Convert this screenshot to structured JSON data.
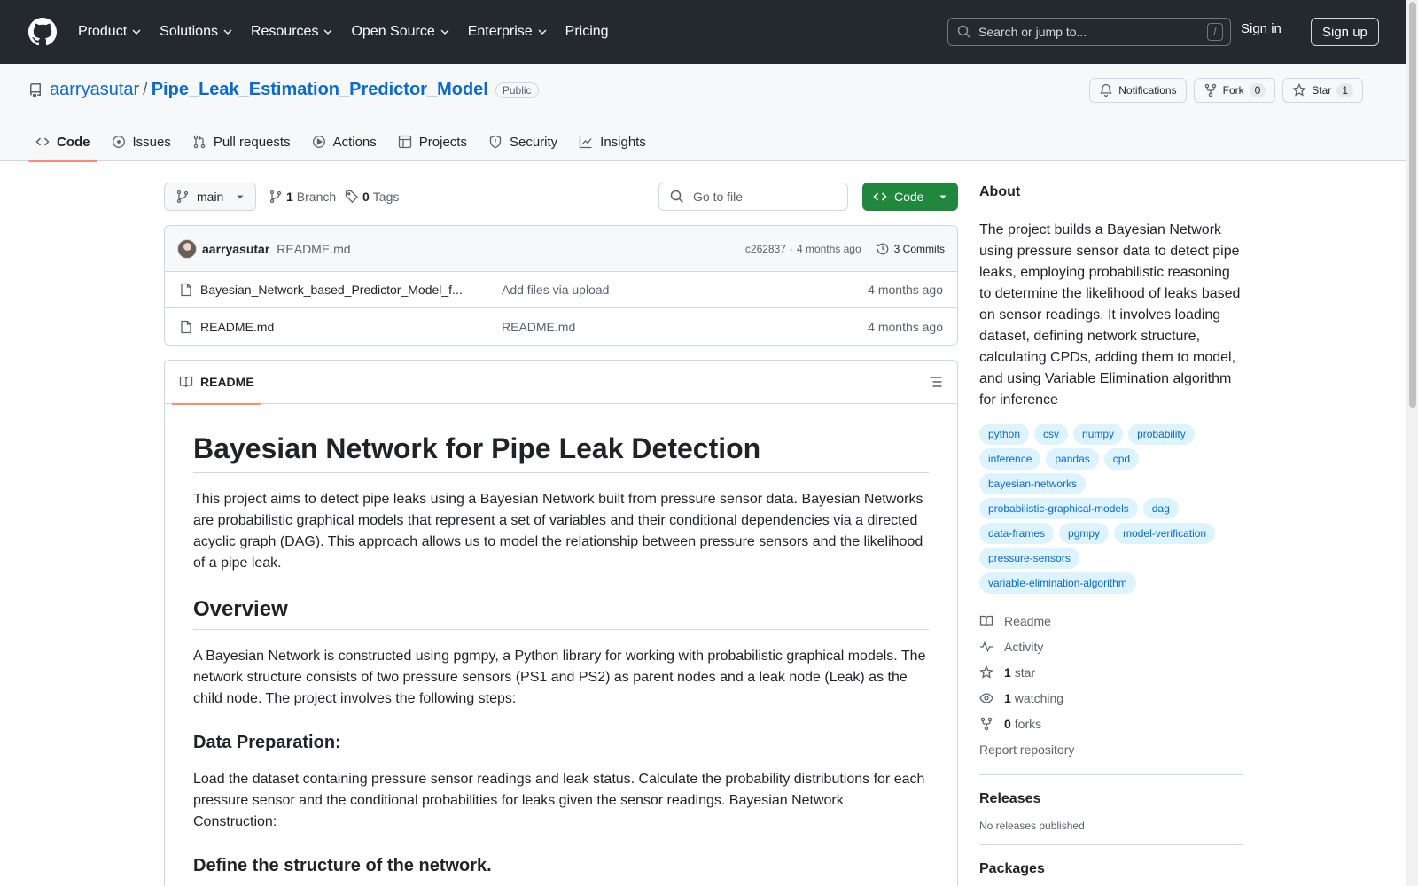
{
  "header": {
    "nav": [
      {
        "label": "Product",
        "dropdown": true
      },
      {
        "label": "Solutions",
        "dropdown": true
      },
      {
        "label": "Resources",
        "dropdown": true
      },
      {
        "label": "Open Source",
        "dropdown": true
      },
      {
        "label": "Enterprise",
        "dropdown": true
      },
      {
        "label": "Pricing",
        "dropdown": false
      }
    ],
    "search_placeholder": "Search or jump to...",
    "search_shortcut": "/",
    "sign_in": "Sign in",
    "sign_up": "Sign up"
  },
  "repo": {
    "owner": "aarryasutar",
    "separator": "/",
    "name": "Pipe_Leak_Estimation_Predictor_Model",
    "visibility": "Public",
    "notifications_label": "Notifications",
    "fork_label": "Fork",
    "fork_count": "0",
    "star_label": "Star",
    "star_count": "1",
    "tabs": [
      "Code",
      "Issues",
      "Pull requests",
      "Actions",
      "Projects",
      "Security",
      "Insights"
    ]
  },
  "toolbar": {
    "branch": "main",
    "branch_count": "1",
    "branch_label": "Branch",
    "tag_count": "0",
    "tag_label": "Tags",
    "goto_placeholder": "Go to file",
    "code_label": "Code"
  },
  "commit": {
    "author": "aarryasutar",
    "message": "README.md",
    "hash": "c262837",
    "dot": "·",
    "age": "4 months ago",
    "commits_label": "3 Commits"
  },
  "files": [
    {
      "name": "Bayesian_Network_based_Predictor_Model_f...",
      "commit": "Add files via upload",
      "age": "4 months ago"
    },
    {
      "name": "README.md",
      "commit": "README.md",
      "age": "4 months ago"
    }
  ],
  "readme": {
    "tab_label": "README",
    "h1": "Bayesian Network for Pipe Leak Detection",
    "p1": "This project aims to detect pipe leaks using a Bayesian Network built from pressure sensor data. Bayesian Networks are probabilistic graphical models that represent a set of variables and their conditional dependencies via a directed acyclic graph (DAG). This approach allows us to model the relationship between pressure sensors and the likelihood of a pipe leak.",
    "h2": "Overview",
    "p2": "A Bayesian Network is constructed using pgmpy, a Python library for working with probabilistic graphical models. The network structure consists of two pressure sensors (PS1 and PS2) as parent nodes and a leak node (Leak) as the child node. The project involves the following steps:",
    "h3a": "Data Preparation:",
    "p3": "Load the dataset containing pressure sensor readings and leak status. Calculate the probability distributions for each pressure sensor and the conditional probabilities for leaks given the sensor readings. Bayesian Network Construction:",
    "h3b": "Define the structure of the network."
  },
  "about": {
    "heading": "About",
    "description": "The project builds a Bayesian Network using pressure sensor data to detect pipe leaks, employing probabilistic reasoning to determine the likelihood of leaks based on sensor readings. It involves loading dataset, defining network structure, calculating CPDs, adding them to model, and using Variable Elimination algorithm for inference",
    "topics": [
      "python",
      "csv",
      "numpy",
      "probability",
      "inference",
      "pandas",
      "cpd",
      "bayesian-networks",
      "probabilistic-graphical-models",
      "dag",
      "data-frames",
      "pgmpy",
      "model-verification",
      "pressure-sensors",
      "variable-elimination-algorithm"
    ],
    "readme_label": "Readme",
    "activity_label": "Activity",
    "stars_count": "1",
    "stars_label": "star",
    "watching_count": "1",
    "watching_label": "watching",
    "forks_count": "0",
    "forks_label": "forks",
    "report_label": "Report repository"
  },
  "releases": {
    "heading": "Releases",
    "empty": "No releases published"
  },
  "packages": {
    "heading": "Packages"
  },
  "colors": {
    "header_bg": "#24292f",
    "link": "#0969da",
    "primary_button": "#1f883d",
    "tab_underline": "#fd8c73",
    "topic_bg": "#ddf4ff"
  }
}
